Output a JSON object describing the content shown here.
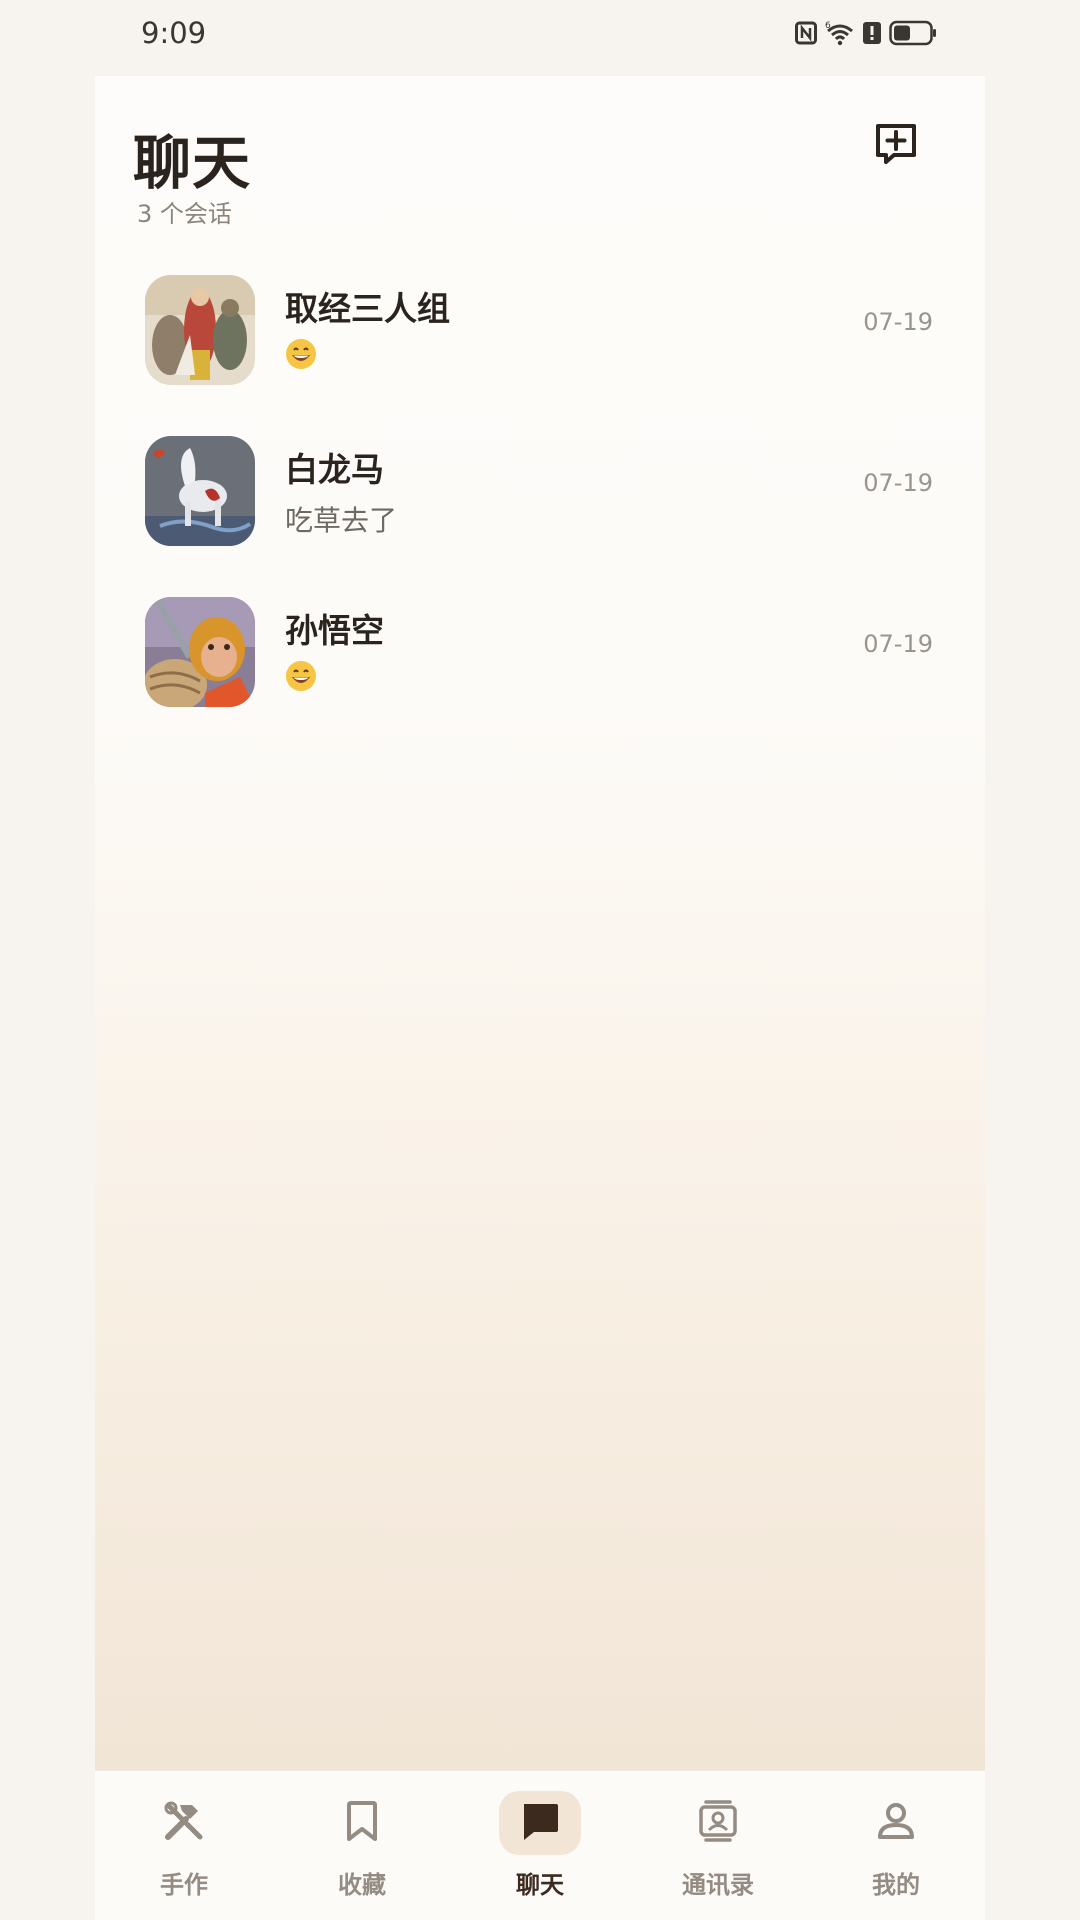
{
  "status_bar": {
    "time": "9:09",
    "icons": [
      "nfc-icon",
      "wifi-icon",
      "alert-icon",
      "battery-icon"
    ]
  },
  "header": {
    "title": "聊天",
    "subtitle": "3 个会话",
    "new_chat_icon": "add-chat-icon"
  },
  "conversations": [
    {
      "name": "取经三人组",
      "preview": "😄",
      "time": "07-19",
      "avatar": "group-avatar"
    },
    {
      "name": "白龙马",
      "preview": "吃草去了",
      "time": "07-19",
      "avatar": "white-dragon-horse-avatar"
    },
    {
      "name": "孙悟空",
      "preview": "😄",
      "time": "07-19",
      "avatar": "monkey-king-avatar"
    }
  ],
  "tabbar": {
    "tabs": [
      {
        "label": "手作",
        "icon": "tools-icon"
      },
      {
        "label": "收藏",
        "icon": "bookmark-icon"
      },
      {
        "label": "聊天",
        "icon": "chat-bubble-icon",
        "active": true
      },
      {
        "label": "通讯录",
        "icon": "contacts-icon"
      },
      {
        "label": "我的",
        "icon": "profile-icon"
      }
    ]
  },
  "colors": {
    "active_tab_bg": "#f2e5d6",
    "title_text": "#2b241e",
    "muted_text": "#9a948d"
  }
}
